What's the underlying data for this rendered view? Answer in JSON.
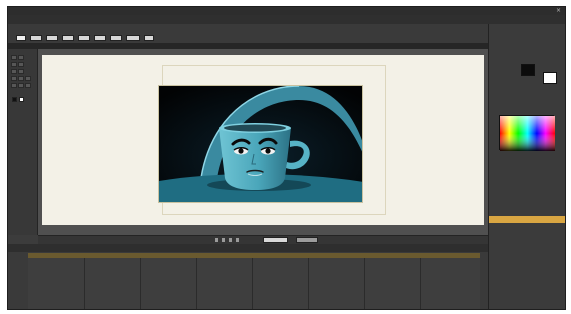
{
  "window": {
    "title": "",
    "menu": [
      "",
      "",
      "",
      "",
      "",
      "",
      "",
      "",
      "",
      ""
    ]
  },
  "toolbar": {
    "row1_text": "",
    "row2_text": ""
  },
  "stage_controls": {
    "zoom": "",
    "frame": ""
  },
  "timeline": {
    "tabs": [
      "",
      "",
      "",
      ""
    ]
  },
  "right_panel": {
    "tabs": [
      "",
      ""
    ],
    "layers": [
      "",
      "",
      ""
    ]
  },
  "colors": {
    "accent": "#f2a640",
    "stage_bg": "#f3f1e7",
    "video_bg": "#050608"
  }
}
